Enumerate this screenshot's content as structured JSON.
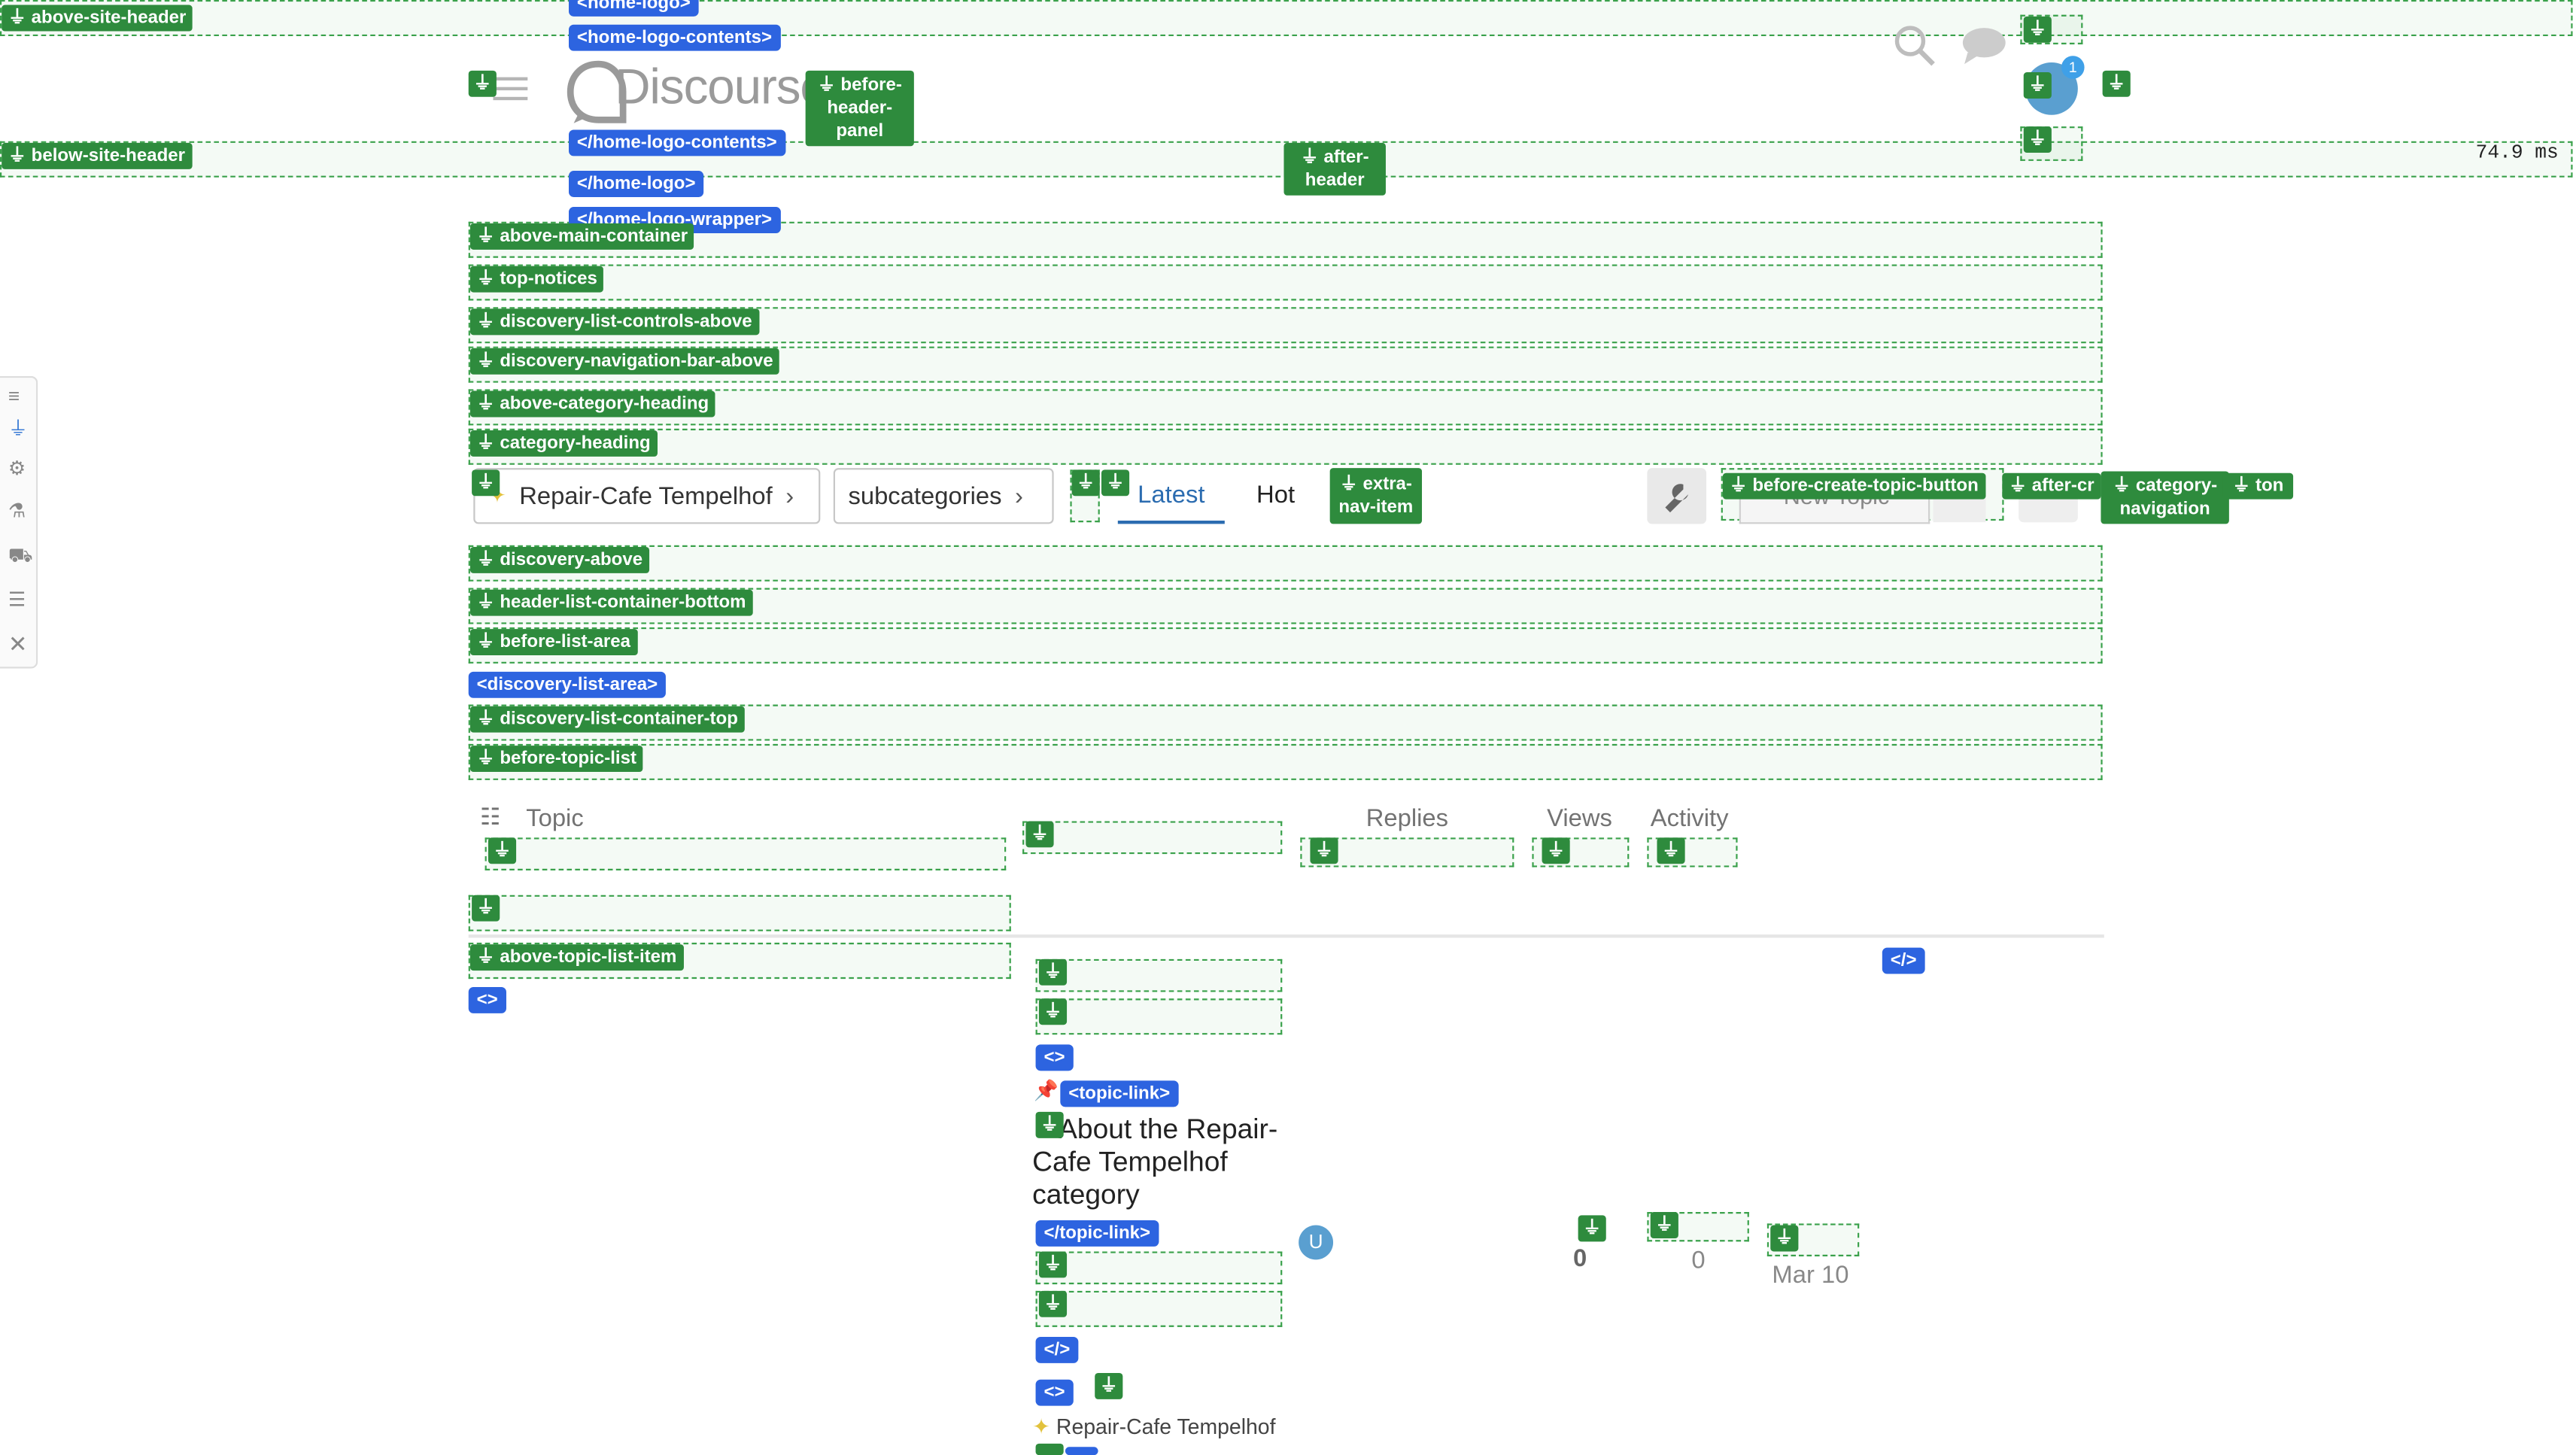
{
  "outlets": {
    "above_site_header": "above-site-header",
    "below_site_header": "below-site-header",
    "before_header_panel": "before-header-panel",
    "after_header": "after-header",
    "above_main_container": "above-main-container",
    "top_notices": "top-notices",
    "discovery_list_controls_above": "discovery-list-controls-above",
    "discovery_navigation_bar_above": "discovery-navigation-bar-above",
    "above_category_heading": "above-category-heading",
    "category_heading": "category-heading",
    "extra_nav_item": "extra-nav-item",
    "before_create_topic_button": "before-create-topic-button",
    "after_create_topic_button": "after-cr",
    "category_navigation": "category-navigation",
    "category_navigation_suffix": "ton",
    "discovery_above": "discovery-above",
    "header_list_container_bottom": "header-list-container-bottom",
    "before_list_area": "before-list-area",
    "discovery_list_container_top": "discovery-list-container-top",
    "before_topic_list": "before-topic-list",
    "above_topic_list_item": "above-topic-list-item"
  },
  "tags": {
    "home_logo_top": "<home-logo>",
    "home_logo_contents": "<home-logo-contents>",
    "home_logo_contents_close": "</home-logo-contents>",
    "home_logo_close": "</home-logo>",
    "home_logo_wrapper_close": "</home-logo-wrapper>",
    "discovery_list_area": "<discovery-list-area>",
    "topic_link_open": "<topic-link>",
    "topic_link_close": "</topic-link>",
    "empty_open": "<>",
    "empty_close": "</>"
  },
  "header": {
    "logo_text": "Discourse",
    "timing": "74.9 ms",
    "avatar_letter": "U",
    "notification_count": "1"
  },
  "nav": {
    "category": "Repair-Cafe Tempelhof",
    "subcategories": "subcategories",
    "tabs": [
      {
        "label": "Latest",
        "active": true
      },
      {
        "label": "Hot",
        "active": false
      }
    ],
    "new_topic_partial": "New Topic"
  },
  "table": {
    "columns": {
      "topic": "Topic",
      "replies": "Replies",
      "views": "Views",
      "activity": "Activity"
    },
    "rows": [
      {
        "title": "About the Repair-Cafe Tempelhof category",
        "category": "Repair-Cafe Tempelhof",
        "poster": "U",
        "replies": "0",
        "views": "0",
        "activity": "Mar 10"
      }
    ]
  },
  "colors": {
    "outlet_green": "#2e8b3d",
    "tag_blue": "#2d64e0",
    "active_tab": "#2b6cb0",
    "avatar": "#5a9fd0"
  }
}
